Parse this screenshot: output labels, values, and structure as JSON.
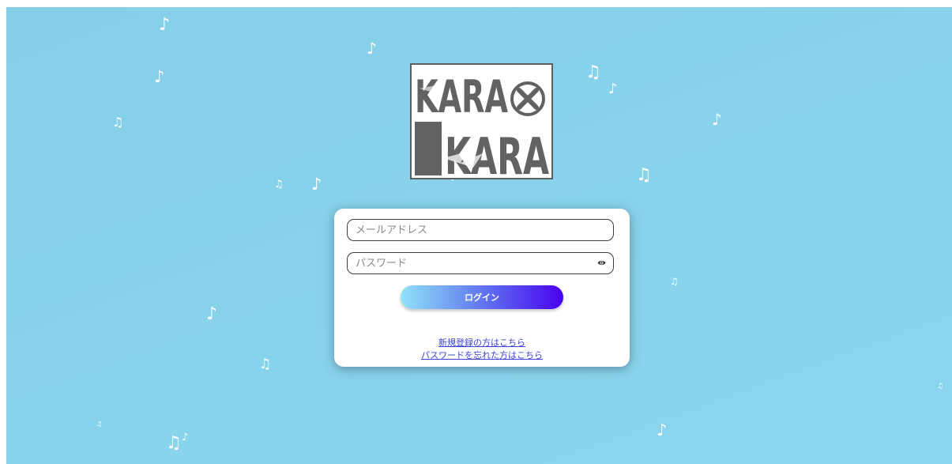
{
  "logo": {
    "line1": "KARA",
    "line2": "KARA",
    "mark": "×"
  },
  "login_form": {
    "email_placeholder": "メールアドレス",
    "password_placeholder": "パスワード",
    "login_label": "ログイン",
    "register_link": "新規登録の方はこちら",
    "forgot_link": "パスワードを忘れた方はこちら"
  },
  "decor": {
    "eighth_note": "♪",
    "beamed_notes": "♫"
  },
  "colors": {
    "background": "#88d3ec",
    "button_start": "#8fe3f6",
    "button_end": "#4a00f0",
    "link": "#3d45d6"
  }
}
